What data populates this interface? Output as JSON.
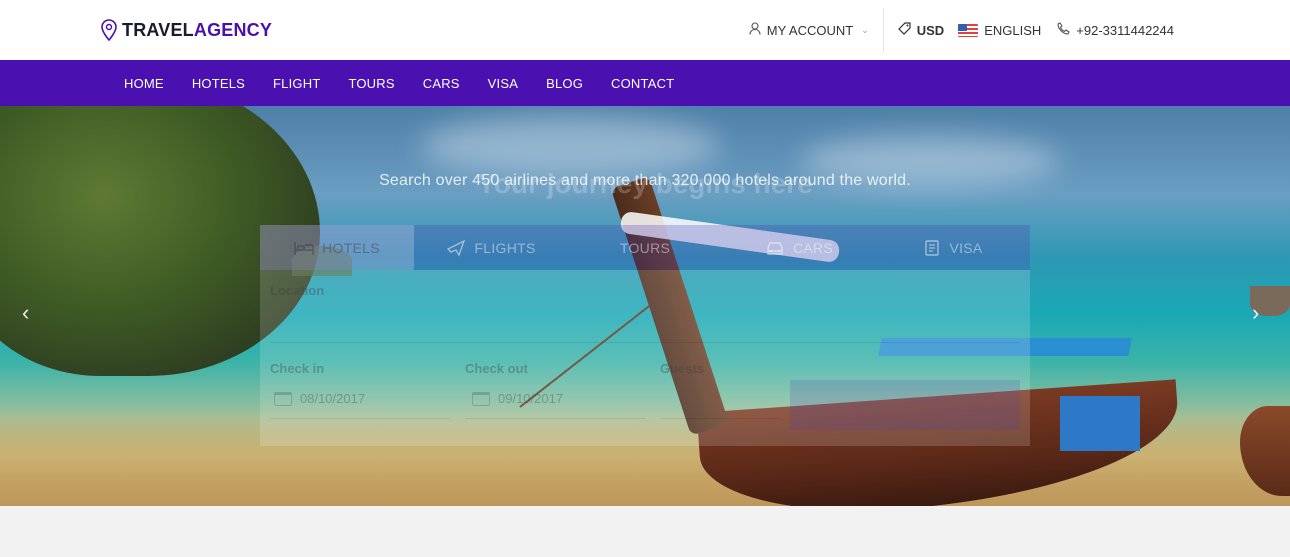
{
  "brand": {
    "name_part1": "TRAVEL",
    "name_part2": "AGENCY"
  },
  "topbar": {
    "account_label": "MY ACCOUNT",
    "currency": "USD",
    "language": "ENGLISH",
    "phone": "+92-3311442244"
  },
  "nav": {
    "items": [
      {
        "label": "HOME"
      },
      {
        "label": "HOTELS"
      },
      {
        "label": "FLIGHT"
      },
      {
        "label": "TOURS"
      },
      {
        "label": "CARS"
      },
      {
        "label": "VISA"
      },
      {
        "label": "BLOG"
      },
      {
        "label": "CONTACT"
      }
    ]
  },
  "hero": {
    "headline": "Your journey begins here",
    "tagline": "Search over 450 airlines and more than 320,000 hotels around the world."
  },
  "search": {
    "tabs": [
      {
        "label": "HOTELS",
        "icon": "bed-icon",
        "active": true
      },
      {
        "label": "FLIGHTS",
        "icon": "plane-icon",
        "active": false
      },
      {
        "label": "TOURS",
        "icon": "",
        "active": false
      },
      {
        "label": "CARS",
        "icon": "car-icon",
        "active": false
      },
      {
        "label": "VISA",
        "icon": "passport-icon",
        "active": false
      }
    ],
    "location_label": "Location",
    "checkin_label": "Check in",
    "checkin_value": "08/10/2017",
    "checkout_label": "Check out",
    "checkout_value": "09/10/2017",
    "guests_label": "Guests"
  },
  "colors": {
    "brand_dark": "#1b1b2b",
    "brand_accent": "#4a0fb0",
    "nav_bg": "#4a11b0"
  }
}
